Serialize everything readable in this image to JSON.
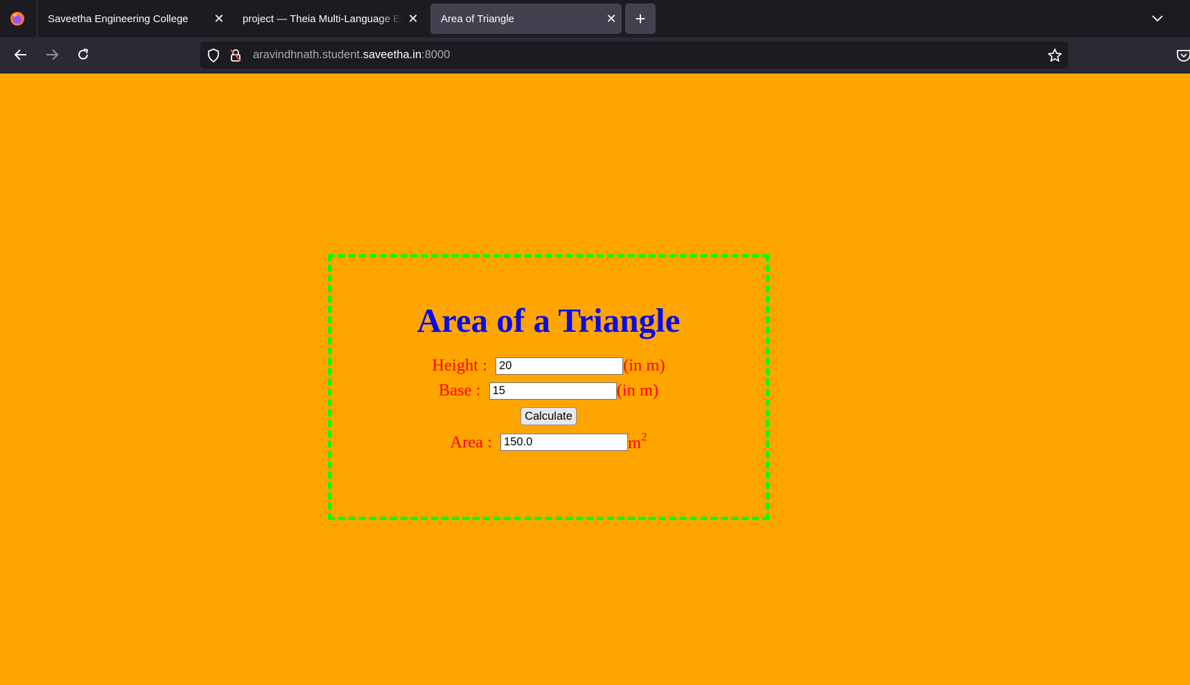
{
  "browser": {
    "tabs": [
      {
        "title": "Saveetha Engineering College",
        "close_icon": "close-icon"
      },
      {
        "title": "project — Theia Multi-Language Ex",
        "close_icon": "close-icon"
      },
      {
        "title": "Area of Triangle",
        "close_icon": "close-icon",
        "active": true
      }
    ],
    "new_tab_glyph": "+",
    "close_glyph": "✕",
    "url": {
      "prefix": "aravindhnath.student.",
      "host": "saveetha.in",
      "suffix": ":8000"
    },
    "icons": [
      "firefox-logo-icon",
      "back-icon",
      "forward-icon",
      "reload-icon",
      "shield-icon",
      "insecure-lock-icon",
      "bookmark-star-icon",
      "pocket-icon",
      "tab-list-icon"
    ]
  },
  "page": {
    "background": "#FFA500",
    "border_color": "#00ff00",
    "heading": "Area of a Triangle",
    "heading_color": "#0a0aeb",
    "label_color": "#ff0000",
    "height": {
      "label": "Height : ",
      "value": "20",
      "unit": "(in m)"
    },
    "base": {
      "label": "Base : ",
      "value": "15",
      "unit": "(in m)"
    },
    "calculate_label": "Calculate",
    "area": {
      "label": "Area : ",
      "value": "150.0",
      "unit": "m",
      "unit_power": "2"
    }
  }
}
